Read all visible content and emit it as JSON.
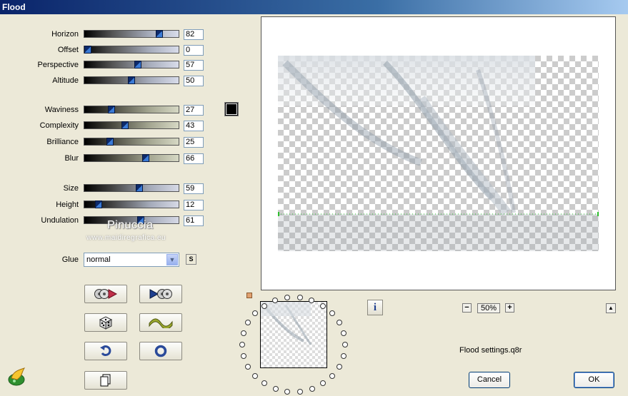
{
  "window": {
    "title": "Flood"
  },
  "sliders": [
    {
      "label": "Horizon",
      "value": "82",
      "fraction": 0.82
    },
    {
      "label": "Offset",
      "value": "0",
      "fraction": 0.0
    },
    {
      "label": "Perspective",
      "value": "57",
      "fraction": 0.57
    },
    {
      "label": "Altitude",
      "value": "50",
      "fraction": 0.5
    },
    {
      "label": "Waviness",
      "value": "27",
      "fraction": 0.27
    },
    {
      "label": "Complexity",
      "value": "43",
      "fraction": 0.43
    },
    {
      "label": "Brilliance",
      "value": "25",
      "fraction": 0.25
    },
    {
      "label": "Blur",
      "value": "66",
      "fraction": 0.66
    },
    {
      "label": "Size",
      "value": "59",
      "fraction": 0.59
    },
    {
      "label": "Height",
      "value": "12",
      "fraction": 0.12
    },
    {
      "label": "Undulation",
      "value": "61",
      "fraction": 0.61
    }
  ],
  "color_swatch": {
    "color": "#000000"
  },
  "watermark": {
    "name": "Pinuccia",
    "url": "www.maidiregrafica.eu"
  },
  "glue": {
    "label": "Glue",
    "value": "normal",
    "s_button": "S"
  },
  "buttons": {
    "load": "load-preset-icon",
    "save": "save-preset-icon",
    "random": "dice-icon",
    "wave": "wave-icon",
    "undo": "undo-icon",
    "reset": "reset-icon",
    "copy": "copy-icon"
  },
  "preview": {
    "zoom": "50%",
    "zoom_minus": "−",
    "zoom_plus": "+",
    "info_label": "i",
    "up_label": "▲"
  },
  "footer": {
    "settings_file": "Flood settings.q8r",
    "cancel": "Cancel",
    "ok": "OK"
  }
}
